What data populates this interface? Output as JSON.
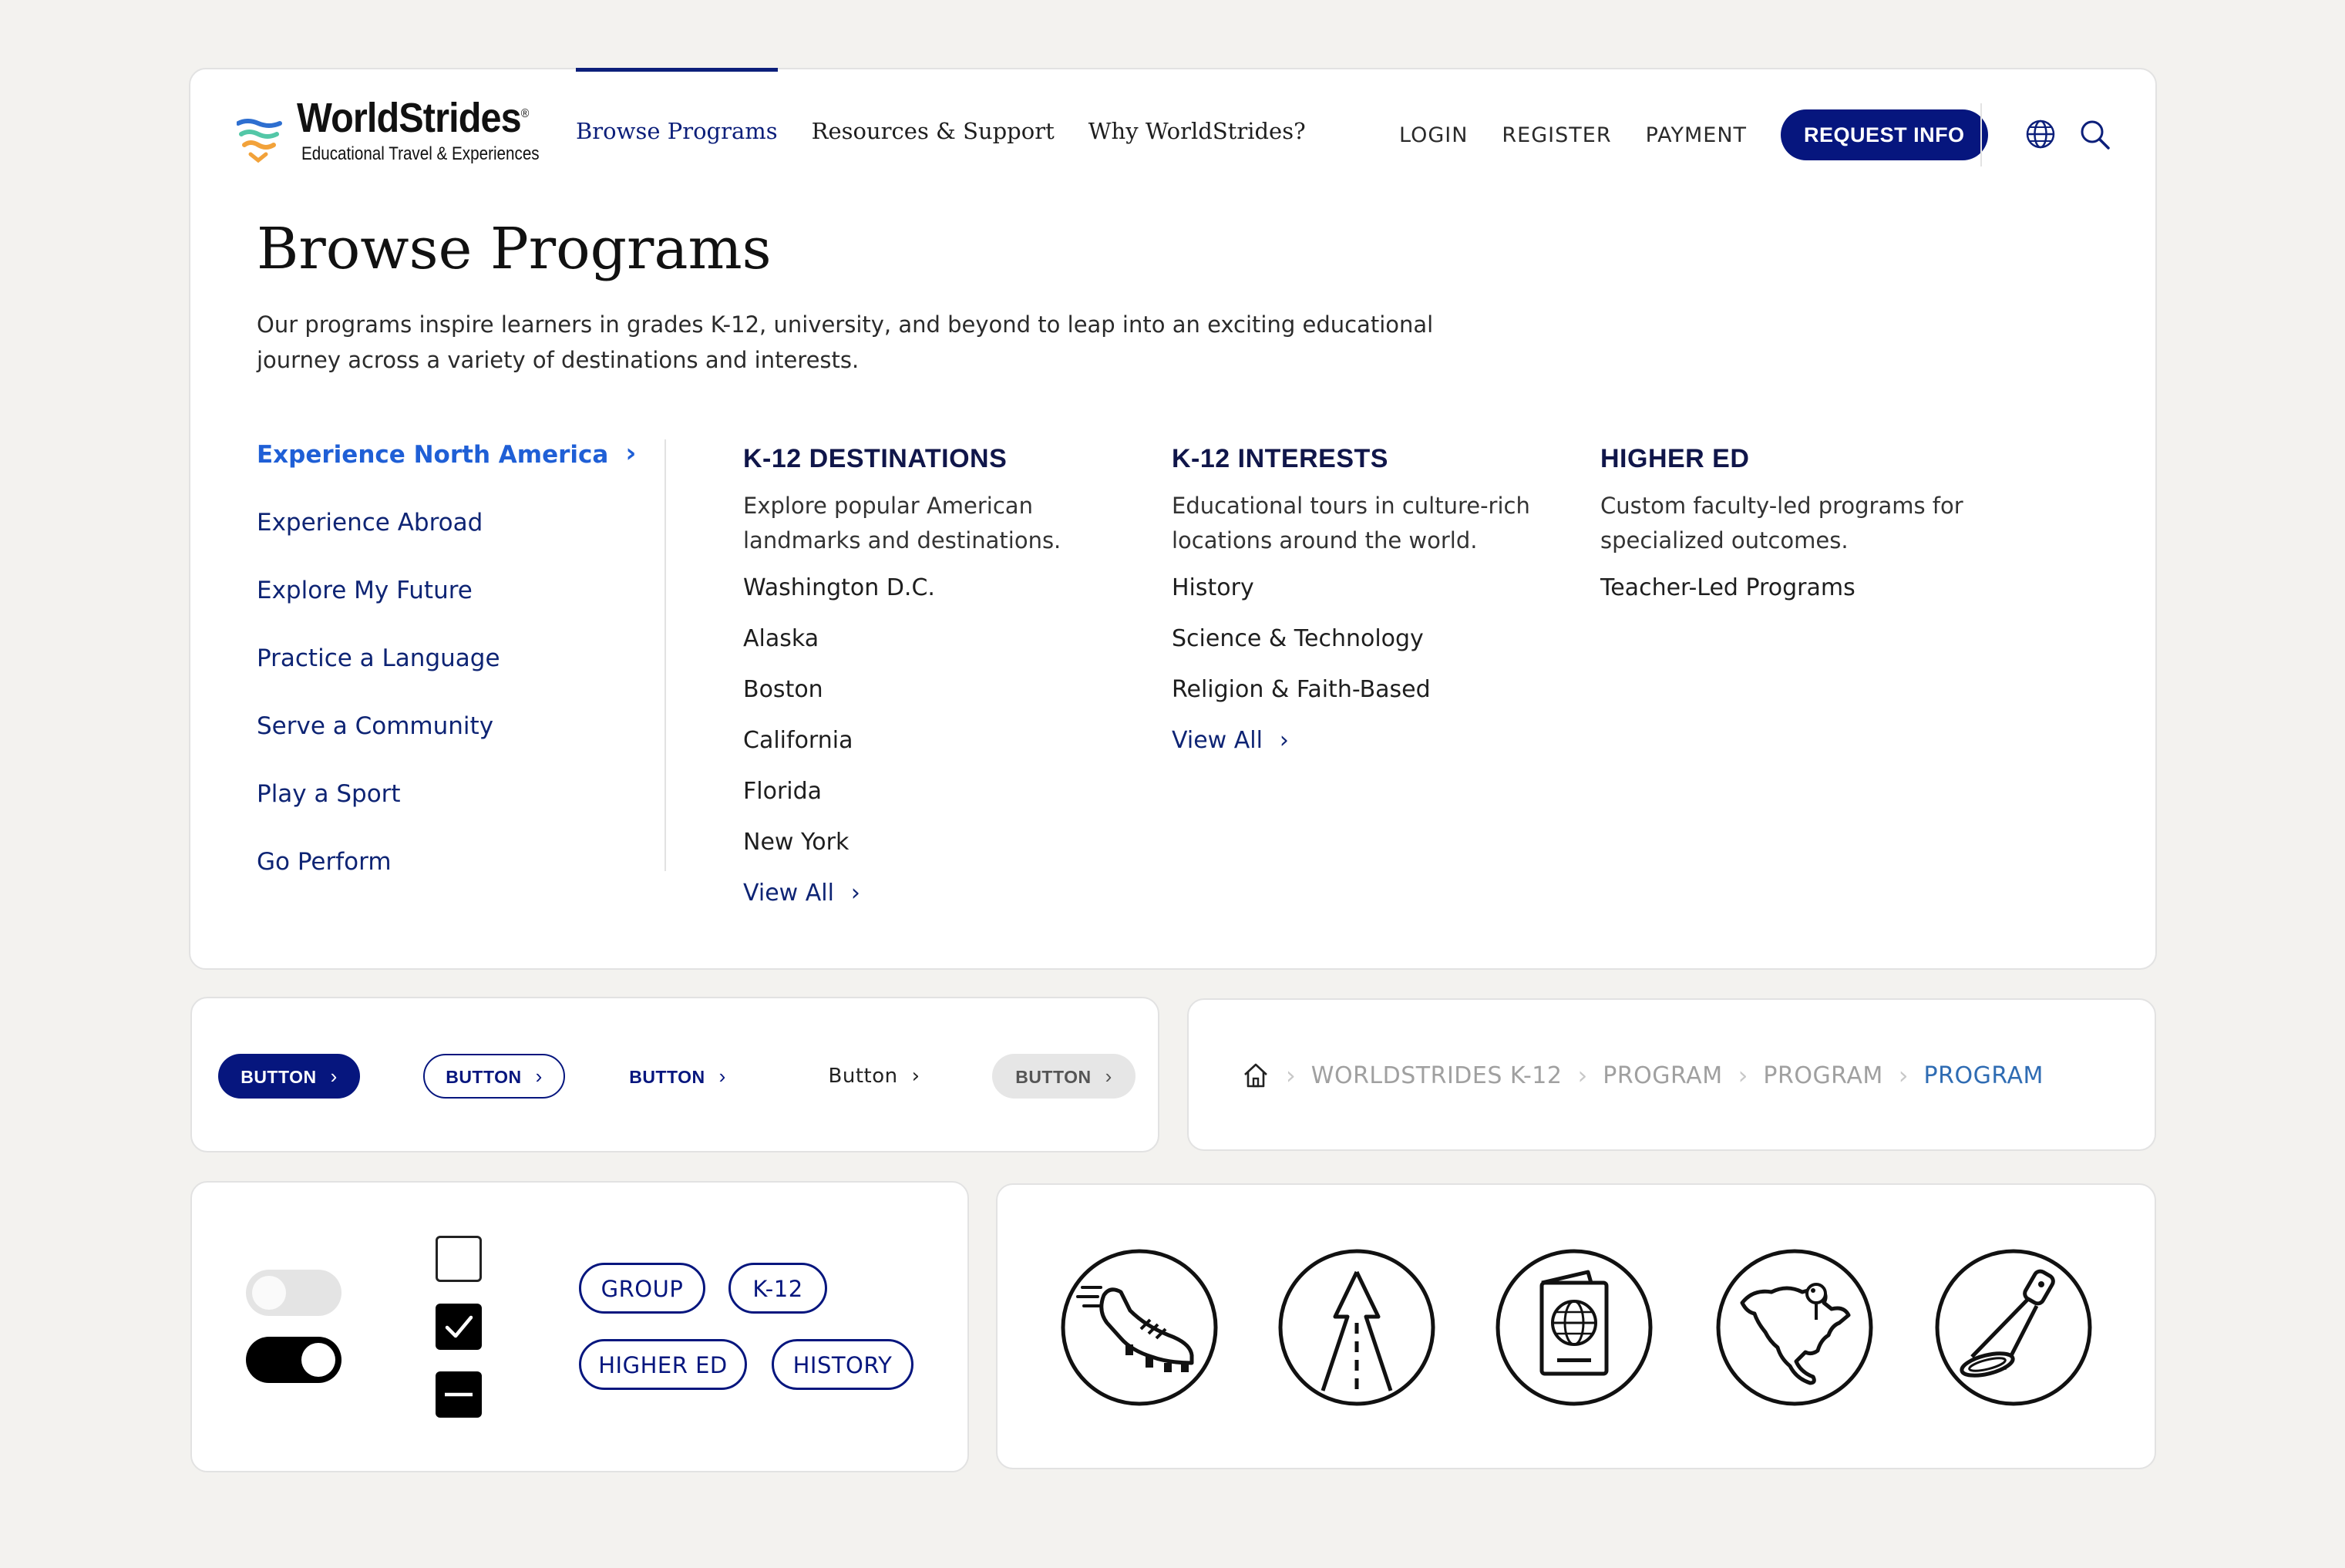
{
  "brand": {
    "name": "WorldStrides",
    "tagline": "Educational Travel & Experiences",
    "registered": "®",
    "colors": {
      "navy": "#06167e",
      "heading": "#10164a",
      "link": "#0e2474",
      "active_link": "#1f5fd6",
      "breadcrumb_current": "#2f6cb3"
    }
  },
  "nav": {
    "main": [
      "Browse Programs",
      "Resources & Support",
      "Why WorldStrides?"
    ],
    "util": [
      "LOGIN",
      "REGISTER",
      "PAYMENT"
    ],
    "cta": "REQUEST INFO",
    "icons": [
      "globe-icon",
      "search-icon"
    ]
  },
  "mega": {
    "title": "Browse Programs",
    "intro": "Our programs inspire learners in grades K-12, university, and beyond to leap into an exciting educational journey across a variety of destinations and interests.",
    "left_nav": [
      "Experience North America",
      "Experience Abroad",
      "Explore My Future",
      "Practice a Language",
      "Serve a Community",
      "Play a Sport",
      "Go Perform"
    ],
    "columns": [
      {
        "heading": "K-12 DESTINATIONS",
        "desc": "Explore popular American landmarks and destinations.",
        "links": [
          "Washington D.C.",
          "Alaska",
          "Boston",
          "California",
          "Florida",
          "New York"
        ],
        "view_all": "View All"
      },
      {
        "heading": "K-12 INTERESTS",
        "desc": "Educational tours in culture-rich locations around the world.",
        "links": [
          "History",
          "Science & Technology",
          "Religion & Faith-Based"
        ],
        "view_all": "View All"
      },
      {
        "heading": "HIGHER ED",
        "desc": "Custom faculty-led programs for specialized outcomes.",
        "links": [
          "Teacher-Led Programs"
        ]
      }
    ]
  },
  "buttons": [
    "BUTTON",
    "BUTTON",
    "BUTTON",
    "Button",
    "BUTTON"
  ],
  "breadcrumb": [
    "WORLDSTRIDES K-12",
    "PROGRAM",
    "PROGRAM",
    "PROGRAM"
  ],
  "controls": {
    "toggles": [
      {
        "on": false
      },
      {
        "on": true
      }
    ],
    "checkboxes": [
      "unchecked",
      "checked",
      "indeterminate"
    ],
    "chips": [
      "GROUP",
      "K-12",
      "HIGHER ED",
      "HISTORY"
    ]
  },
  "icons": [
    "cleat-shoe-icon",
    "road-arrow-icon",
    "passport-icon",
    "north-america-map-icon",
    "spotlight-icon"
  ]
}
